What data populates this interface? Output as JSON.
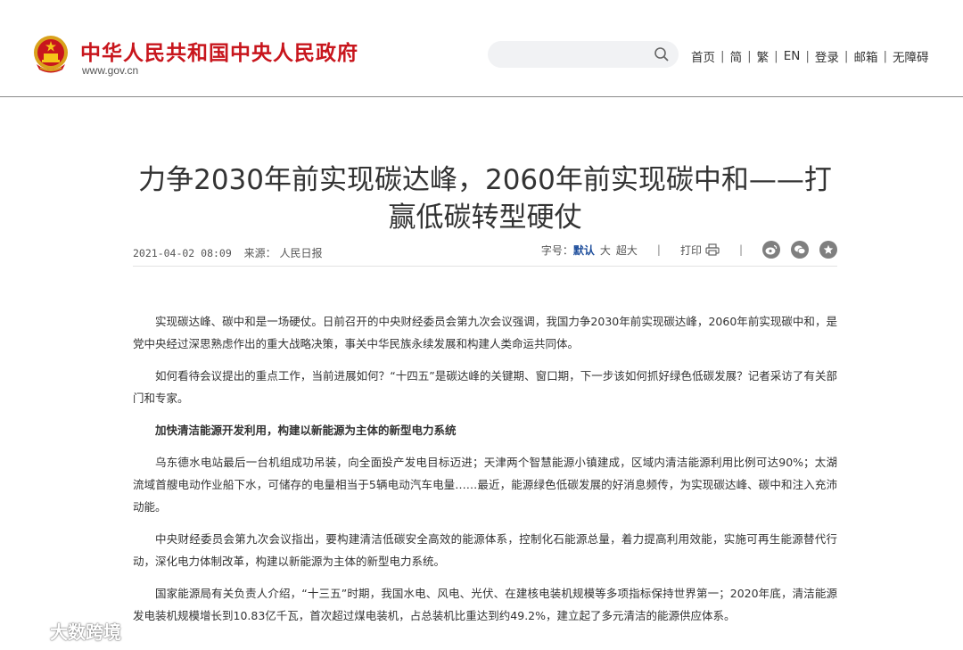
{
  "header": {
    "site_name": "中华人民共和国中央人民政府",
    "site_url": "www.gov.cn",
    "search": {
      "placeholder": "",
      "value": ""
    },
    "nav": [
      "首页",
      "简",
      "繁",
      "EN",
      "登录",
      "邮箱",
      "无障碍"
    ]
  },
  "article": {
    "title": "力争2030年前实现碳达峰，2060年前实现碳中和——打赢低碳转型硬仗",
    "date": "2021-04-02 08:09",
    "source_label": "来源：",
    "source": "人民日报",
    "font_size_label": "字号：",
    "font_sizes": [
      "默认",
      "大",
      "超大"
    ],
    "print_label": "打印",
    "paragraphs": [
      "实现碳达峰、碳中和是一场硬仗。日前召开的中央财经委员会第九次会议强调，我国力争2030年前实现碳达峰，2060年前实现碳中和，是党中央经过深思熟虑作出的重大战略决策，事关中华民族永续发展和构建人类命运共同体。",
      "如何看待会议提出的重点工作，当前进展如何？“十四五”是碳达峰的关键期、窗口期，下一步该如何抓好绿色低碳发展？记者采访了有关部门和专家。",
      "加快清洁能源开发利用，构建以新能源为主体的新型电力系统",
      "乌东德水电站最后一台机组成功吊装，向全面投产发电目标迈进；天津两个智慧能源小镇建成，区域内清洁能源利用比例可达90%；太湖流域首艘电动作业船下水，可储存的电量相当于5辆电动汽车电量……最近，能源绿色低碳发展的好消息频传，为实现碳达峰、碳中和注入充沛动能。",
      "中央财经委员会第九次会议指出，要构建清洁低碳安全高效的能源体系，控制化石能源总量，着力提高利用效能，实施可再生能源替代行动，深化电力体制改革，构建以新能源为主体的新型电力系统。",
      "国家能源局有关负责人介绍，“十三五”时期，我国水电、风电、光伏、在建核电装机规模等多项指标保持世界第一；2020年底，清洁能源发电装机规模增长到10.83亿千瓦，首次超过煤电装机，占总装机比重达到约49.2%，建立起了多元清洁的能源供应体系。"
    ]
  },
  "watermark": "大数跨境",
  "colors": {
    "brand_red": "#c8161d",
    "accent_blue": "#1e4e9c"
  }
}
